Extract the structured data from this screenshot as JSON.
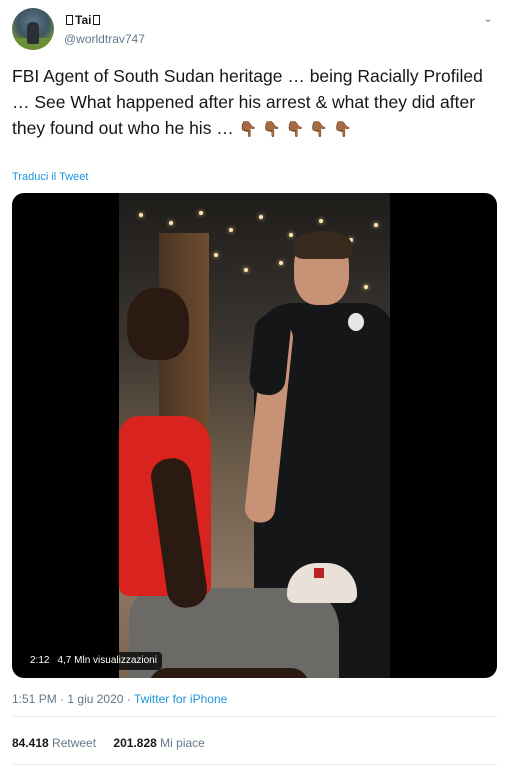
{
  "user": {
    "name": "Tai",
    "handle": "@worldtrav747",
    "avatar_icon": "profile-avatar"
  },
  "tweet": {
    "text": "FBI Agent of South Sudan heritage … being Racially Profiled … See What happened after his arrest & what they did after they found out who he his …",
    "emoji": "👇🏾",
    "emoji_count": 5,
    "translate_label": "Traduci il Tweet"
  },
  "video": {
    "duration": "2:12",
    "views": "4,7 Mln visualizzazioni"
  },
  "meta": {
    "time": "1:51 PM",
    "date": "1 giu 2020",
    "separator": "·",
    "source": "Twitter for iPhone"
  },
  "stats": {
    "retweets_count": "84.418",
    "retweets_label": "Retweet",
    "likes_count": "201.828",
    "likes_label": "Mi piace"
  },
  "colors": {
    "link": "#1b95e0",
    "secondary_text": "#657786",
    "primary_text": "#14171a",
    "divider": "#e6ecf0"
  }
}
